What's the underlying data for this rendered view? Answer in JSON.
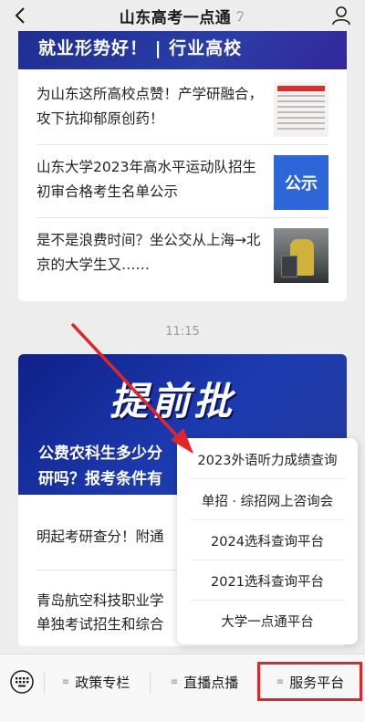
{
  "header": {
    "title": "山东高考一点通",
    "back_icon": "chevron-left-icon",
    "ear_icon": "ear-icon",
    "user_icon": "user-icon"
  },
  "card1": {
    "banner_text": "就业形势好！ | 行业高校",
    "items": [
      {
        "text": "为山东这所高校点赞！产学研融合，攻下抗抑郁原创药！",
        "thumb": "news-clipping"
      },
      {
        "text": "山东大学2023年高水平运动队招生初审合格考生名单公示",
        "thumb_label": "公示"
      },
      {
        "text": "是不是浪费时间？坐公交从上海→北京的大学生又……",
        "thumb": "photo"
      }
    ]
  },
  "timestamp": "11:15",
  "card2": {
    "hero_big": "提前批",
    "hero_line1": "公费农科生多少分",
    "hero_line2": "研吗？报考条件有",
    "row1": "明起考研查分！附通",
    "row2": "青岛航空科技职业学",
    "row3": "单独考试招生和综合"
  },
  "popup": {
    "items": [
      "2023外语听力成绩查询",
      "单招 · 综招网上咨询会",
      "2024选科查询平台",
      "2021选科查询平台",
      "大学一点通平台"
    ]
  },
  "bottombar": {
    "keyboard_icon": "keyboard-icon",
    "tabs": [
      "政策专栏",
      "直播点播",
      "服务平台"
    ],
    "menu_icon": "≡"
  },
  "colors": {
    "highlight": "#e0262b",
    "banner": "#1d2d8f",
    "background": "#ededed"
  }
}
